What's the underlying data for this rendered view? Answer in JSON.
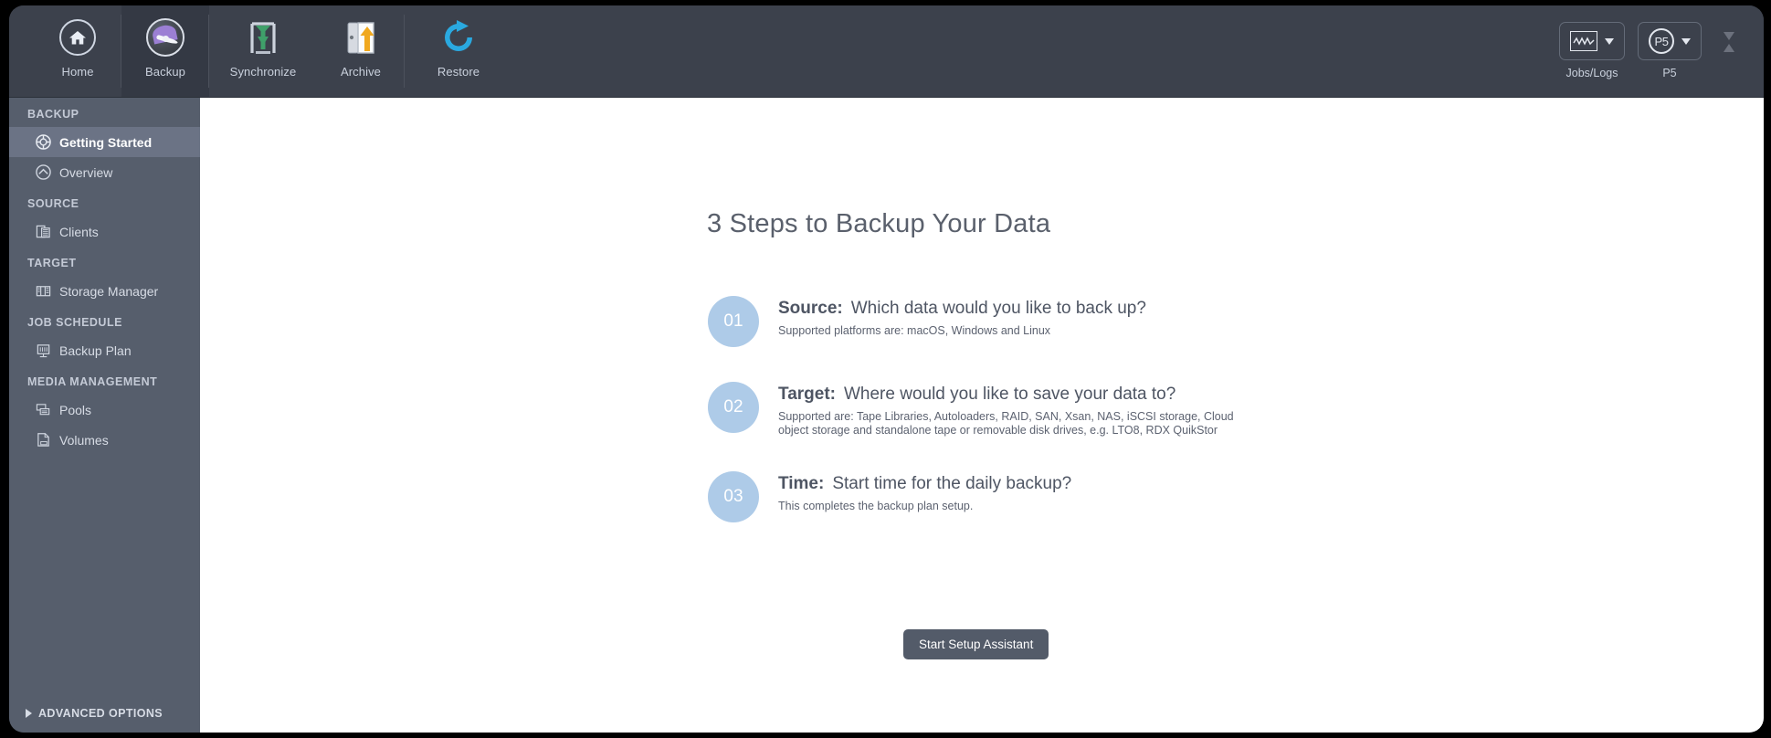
{
  "toolbar": {
    "tabs": [
      {
        "label": "Home",
        "icon": "home-icon",
        "active": false
      },
      {
        "label": "Backup",
        "icon": "gauge-icon",
        "active": true
      },
      {
        "label": "Synchronize",
        "icon": "synchronize-icon",
        "active": false
      },
      {
        "label": "Archive",
        "icon": "archive-icon",
        "active": false
      },
      {
        "label": "Restore",
        "icon": "restore-icon",
        "active": false
      }
    ],
    "right_items": [
      {
        "label": "Jobs/Logs",
        "icon": "wave-chart-icon"
      },
      {
        "label": "P5",
        "icon": "p5-logo-icon"
      }
    ],
    "busy_icon": "hourglass-icon"
  },
  "sidebar": {
    "groups": [
      {
        "title": "BACKUP",
        "items": [
          {
            "label": "Getting Started",
            "icon": "lifebuoy-icon",
            "active": true
          },
          {
            "label": "Overview",
            "icon": "overview-icon",
            "active": false
          }
        ]
      },
      {
        "title": "SOURCE",
        "items": [
          {
            "label": "Clients",
            "icon": "clients-icon",
            "active": false
          }
        ]
      },
      {
        "title": "TARGET",
        "items": [
          {
            "label": "Storage Manager",
            "icon": "storage-icon",
            "active": false
          }
        ]
      },
      {
        "title": "JOB SCHEDULE",
        "items": [
          {
            "label": "Backup Plan",
            "icon": "plan-icon",
            "active": false
          }
        ]
      },
      {
        "title": "MEDIA MANAGEMENT",
        "items": [
          {
            "label": "Pools",
            "icon": "pools-icon",
            "active": false
          },
          {
            "label": "Volumes",
            "icon": "volumes-icon",
            "active": false
          }
        ]
      }
    ],
    "advanced_options": "ADVANCED OPTIONS"
  },
  "main": {
    "title": "3 Steps to Backup Your Data",
    "steps": [
      {
        "number": "01",
        "label": "Source:",
        "question": "Which data would you like to back up?",
        "description": "Supported platforms are: macOS, Windows and Linux"
      },
      {
        "number": "02",
        "label": "Target:",
        "question": "Where would you like to save your data to?",
        "description": "Supported are: Tape Libraries, Autoloaders, RAID, SAN, Xsan, NAS, iSCSI storage, Cloud object storage and standalone tape or removable disk drives, e.g. LTO8, RDX QuikStor"
      },
      {
        "number": "03",
        "label": "Time:",
        "question": "Start time for the daily backup?",
        "description": "This completes the backup plan setup."
      }
    ],
    "cta_label": "Start Setup Assistant"
  },
  "colors": {
    "window_bg": "#3c414c",
    "sidebar_bg": "#565e6c",
    "sidebar_active": "#6b7385",
    "content_bg": "#ffffff",
    "step_circle": "#aecbe8",
    "cta_bg": "#535b69",
    "heading_text": "#5a606c"
  }
}
